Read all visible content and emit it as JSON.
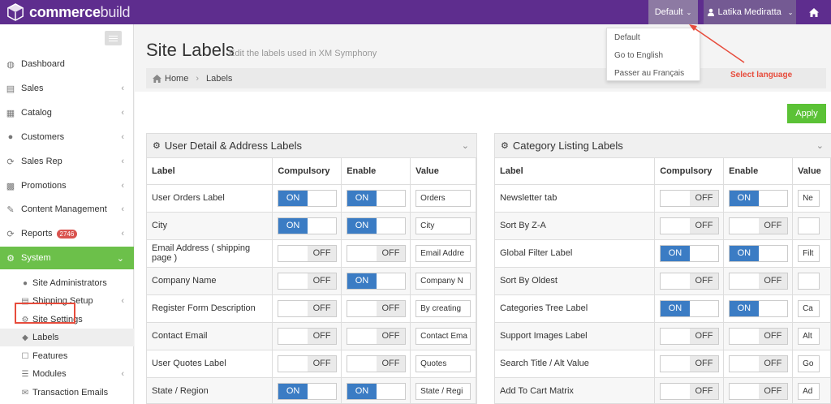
{
  "topbar": {
    "brand_bold": "commerce",
    "brand_light": "build",
    "language": "Default",
    "user": "Latika Mediratta"
  },
  "language_menu": {
    "items": [
      "Default",
      "Go to English",
      "Passer au Français"
    ],
    "annotation": "Select language"
  },
  "sidebar": {
    "items": [
      {
        "label": "Dashboard",
        "icon": "dashboard-icon"
      },
      {
        "label": "Sales",
        "icon": "sales-icon"
      },
      {
        "label": "Catalog",
        "icon": "catalog-icon"
      },
      {
        "label": "Customers",
        "icon": "user-icon"
      },
      {
        "label": "Sales Rep",
        "icon": "refresh-icon"
      },
      {
        "label": "Promotions",
        "icon": "chart-icon"
      },
      {
        "label": "Content Management",
        "icon": "edit-icon"
      },
      {
        "label": "Reports",
        "icon": "refresh-icon",
        "badge": "2746"
      },
      {
        "label": "System",
        "icon": "gears-icon"
      }
    ],
    "sub_items": [
      {
        "label": "Site Administrators",
        "icon": "users-icon"
      },
      {
        "label": "Shipping Setup",
        "icon": "truck-icon"
      },
      {
        "label": "Site Settings",
        "icon": "gear-icon"
      },
      {
        "label": "Labels",
        "icon": "tags-icon"
      },
      {
        "label": "Features",
        "icon": "bookmark-icon"
      },
      {
        "label": "Modules",
        "icon": "list-icon"
      },
      {
        "label": "Transaction Emails",
        "icon": "envelope-icon"
      }
    ]
  },
  "page": {
    "title": "Site Labels",
    "subtitle": "Edit the labels used in XM Symphony",
    "breadcrumb_home": "Home",
    "breadcrumb_current": "Labels",
    "apply": "Apply"
  },
  "toggle_text": {
    "on": "ON",
    "off": "OFF"
  },
  "panel_left": {
    "title": "User Detail & Address Labels",
    "columns": [
      "Label",
      "Compulsory",
      "Enable",
      "Value"
    ],
    "rows": [
      {
        "label": "User Orders Label",
        "compulsory": true,
        "enable": true,
        "value": "Orders"
      },
      {
        "label": "City",
        "compulsory": true,
        "enable": true,
        "value": "City"
      },
      {
        "label": "Email Address ( shipping page )",
        "compulsory": false,
        "enable": false,
        "value": "Email Addre"
      },
      {
        "label": "Company Name",
        "compulsory": false,
        "enable": true,
        "value": "Company N"
      },
      {
        "label": "Register Form Description",
        "compulsory": false,
        "enable": false,
        "value": "By creating"
      },
      {
        "label": "Contact Email",
        "compulsory": false,
        "enable": false,
        "value": "Contact Ema"
      },
      {
        "label": "User Quotes Label",
        "compulsory": false,
        "enable": false,
        "value": "Quotes"
      },
      {
        "label": "State / Region",
        "compulsory": true,
        "enable": true,
        "value": "State / Regi"
      }
    ]
  },
  "panel_right": {
    "title": "Category Listing Labels",
    "columns": [
      "Label",
      "Compulsory",
      "Enable",
      "Value"
    ],
    "rows": [
      {
        "label": "Newsletter tab",
        "compulsory": false,
        "enable": true,
        "value": "Ne"
      },
      {
        "label": "Sort By Z-A",
        "compulsory": false,
        "enable": false,
        "value": ""
      },
      {
        "label": "Global Filter Label",
        "compulsory": true,
        "enable": true,
        "value": "Filt"
      },
      {
        "label": "Sort By Oldest",
        "compulsory": false,
        "enable": false,
        "value": ""
      },
      {
        "label": "Categories Tree Label",
        "compulsory": true,
        "enable": true,
        "value": "Ca"
      },
      {
        "label": "Support Images Label",
        "compulsory": false,
        "enable": false,
        "value": "Alt"
      },
      {
        "label": "Search Title / Alt Value",
        "compulsory": false,
        "enable": false,
        "value": "Go"
      },
      {
        "label": "Add To Cart Matrix",
        "compulsory": false,
        "enable": false,
        "value": "Ad"
      }
    ]
  },
  "colors": {
    "topbar": "#5e2d8e",
    "active_nav": "#6cc04a",
    "toggle_on": "#3b7cc4",
    "apply": "#5bc236",
    "annotation": "#e74c3c"
  }
}
